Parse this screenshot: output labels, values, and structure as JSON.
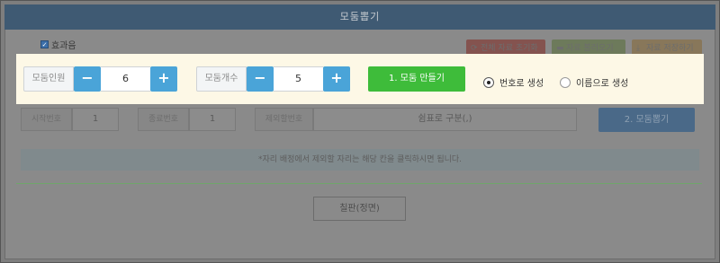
{
  "header": {
    "title": "모둠뽑기"
  },
  "options": {
    "effect_label": "효과음",
    "effect_checked": true
  },
  "toolbar": {
    "reset_label": "전체 자료 초기화",
    "load_label": "자료 불러오기",
    "save_label": "자료 저장하기"
  },
  "group_settings": {
    "members_label": "모둠인원",
    "members_value": "6",
    "groups_label": "모둠개수",
    "groups_value": "5",
    "minus": "−",
    "plus": "+",
    "make_label": "1. 모둠 만들기",
    "radio_number_label": "번호로 생성",
    "radio_name_label": "이름으로 생성",
    "selected_mode": "number"
  },
  "range": {
    "start_label": "시작번호",
    "start_value": "1",
    "end_label": "종료번호",
    "end_value": "1",
    "exclude_label": "제외할번호",
    "exclude_placeholder": "쉼표로 구분(,)",
    "draw_label": "2. 모둠뽑기"
  },
  "notice": {
    "text": "*자리 배정에서 제외할 자리는 해당 칸을 클릭하시면 됩니다."
  },
  "board": {
    "label": "칠판(정면)"
  },
  "colors": {
    "accent_green": "#3ebc3a",
    "accent_blue": "#4aa4d8",
    "highlight": "#fdf8e6"
  }
}
